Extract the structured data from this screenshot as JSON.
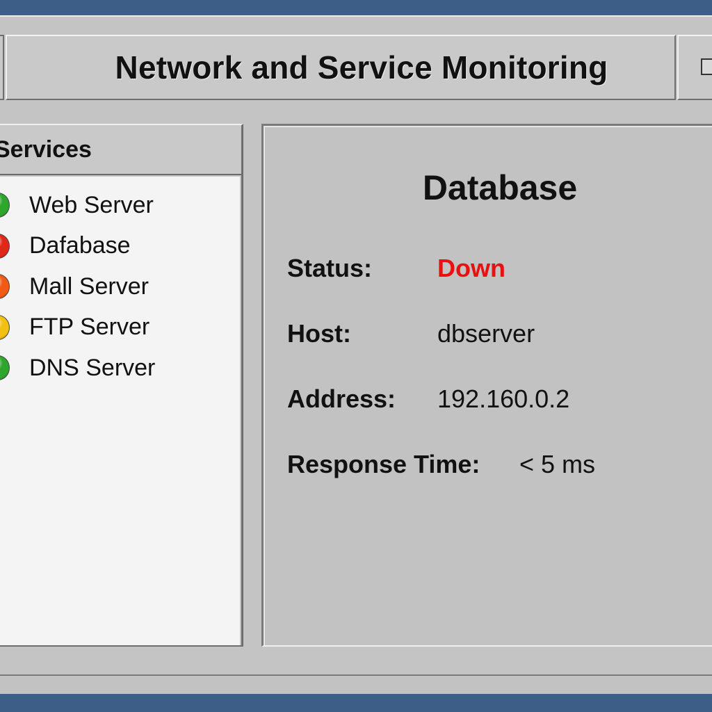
{
  "window": {
    "title": "Network and Service Monitoring"
  },
  "services": {
    "header": "Services",
    "items": [
      {
        "label": "Web Server",
        "status_color": "#2ea52b"
      },
      {
        "label": "Dafabase",
        "status_color": "#e02818"
      },
      {
        "label": "Mall Server",
        "status_color": "#f05a14"
      },
      {
        "label": "FTP Server",
        "status_color": "#f2c010"
      },
      {
        "label": "DNS Server",
        "status_color": "#2ea52b"
      }
    ]
  },
  "detail": {
    "title": "Database",
    "status_label": "Status:",
    "status_value": "Down",
    "status_color": "#e81010",
    "host_label": "Host:",
    "host_value": "dbserver",
    "address_label": "Address:",
    "address_value": "192.160.0.2",
    "response_label": "Response Time:",
    "response_value": "< 5 ms"
  }
}
